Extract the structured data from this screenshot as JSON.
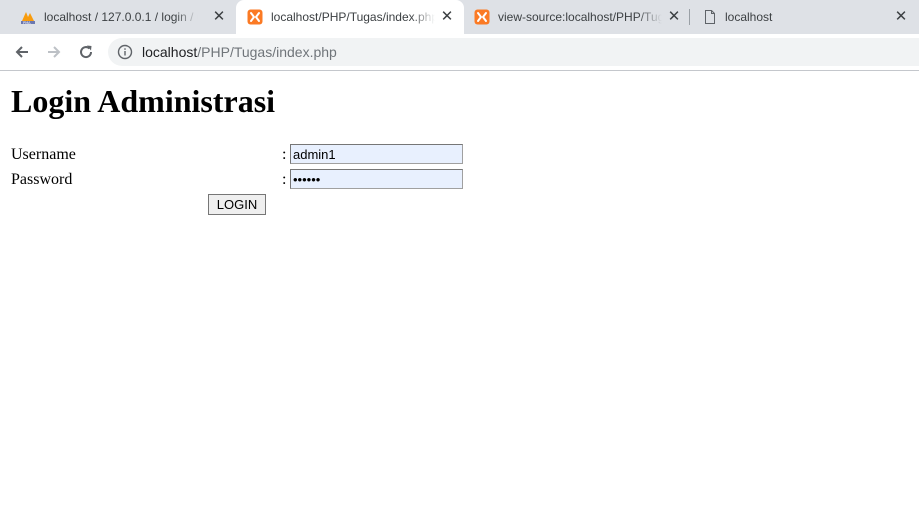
{
  "browser": {
    "tabs": [
      {
        "title": "localhost / 127.0.0.1 / login / u",
        "favicon": "phpmyadmin-icon",
        "active": false
      },
      {
        "title": "localhost/PHP/Tugas/index.php",
        "favicon": "xampp-icon",
        "active": true
      },
      {
        "title": "view-source:localhost/PHP/Tug",
        "favicon": "xampp-icon",
        "active": false
      },
      {
        "title": "localhost",
        "favicon": "document-icon",
        "active": false
      }
    ],
    "close_glyph": "✕",
    "address": {
      "host": "localhost",
      "path": "/PHP/Tugas/index.php"
    }
  },
  "page": {
    "title": "Login Administrasi",
    "form": {
      "username_label": "Username",
      "password_label": "Password",
      "separator": ":",
      "username_value": "admin1",
      "password_value": "••••••",
      "submit_label": "LOGIN"
    }
  },
  "colors": {
    "tabstrip_bg": "#dee1e6",
    "omnibox_bg": "#f1f3f4",
    "autofill_bg": "#e8f0fe",
    "xampp_orange": "#fb7a24",
    "pma_orange": "#f89c0e"
  }
}
